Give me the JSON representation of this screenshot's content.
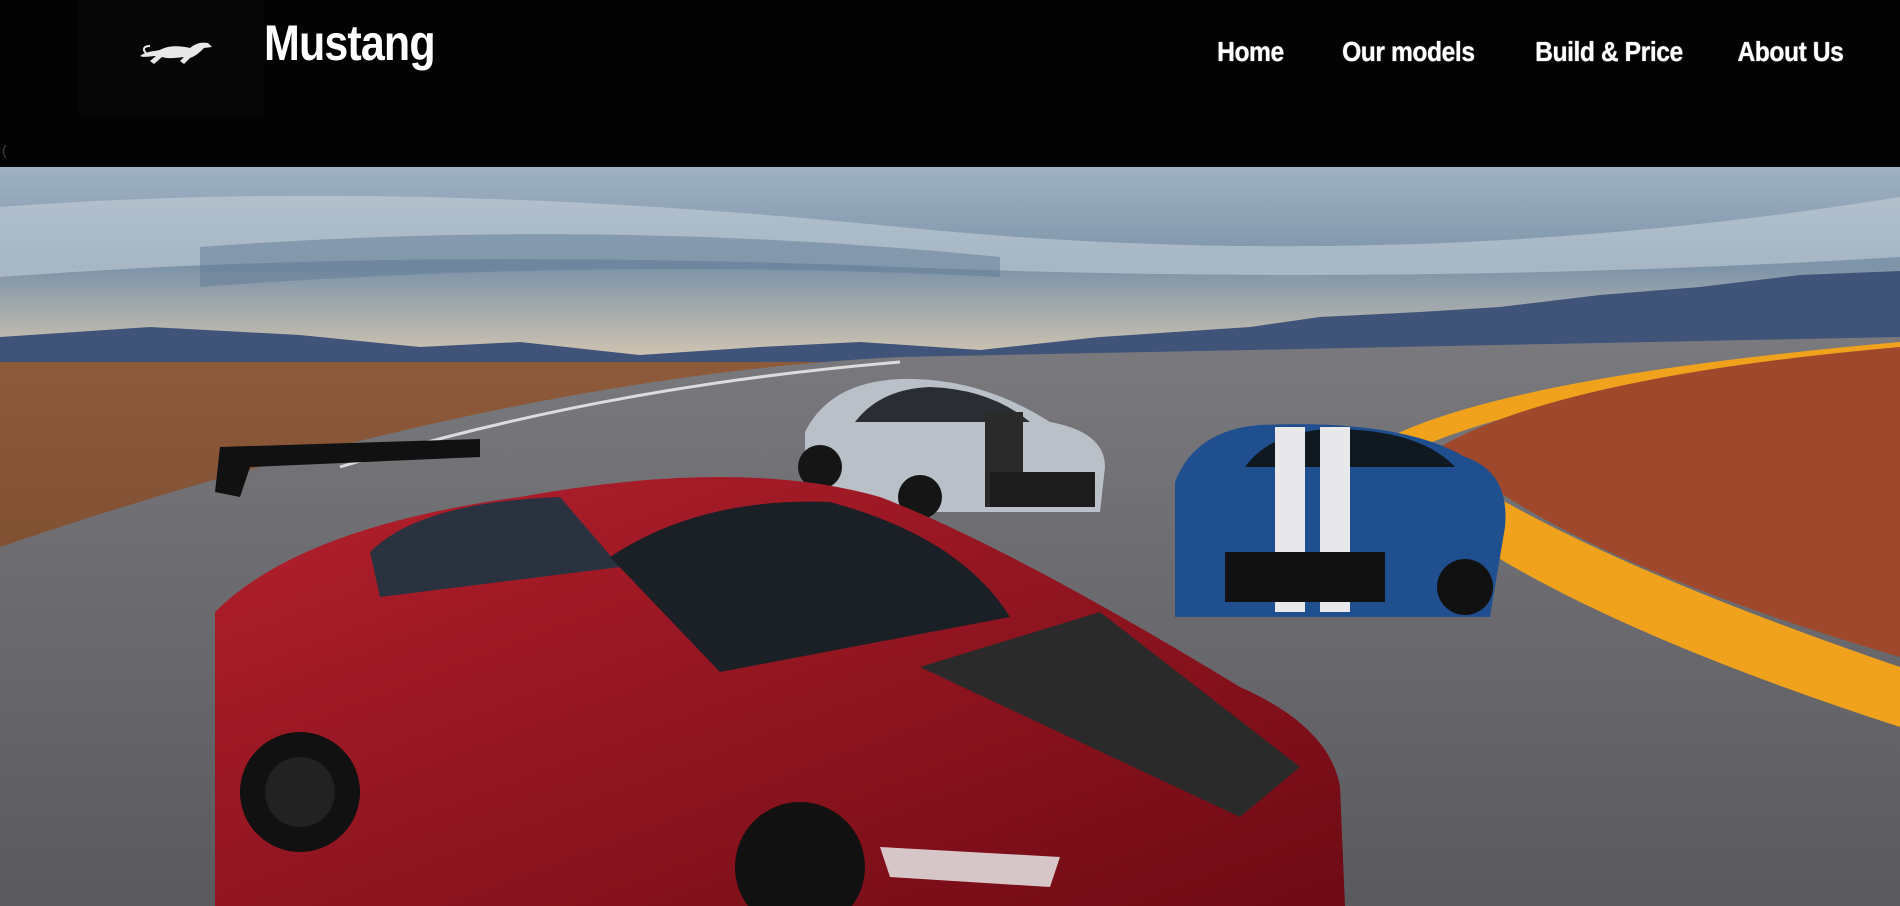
{
  "brand": {
    "name": "Mustang",
    "logo_icon": "running-horse-icon"
  },
  "nav": {
    "items": [
      {
        "label": "Home"
      },
      {
        "label": "Our models"
      },
      {
        "label": "Build & Price"
      },
      {
        "label": "About Us"
      }
    ]
  },
  "hero": {
    "image": "three Ford Mustang Shelby GT500 cars (red, silver, blue) on a desert race track",
    "colors": {
      "red_car": "#9b0f1c",
      "silver_car": "#b9c0c8",
      "blue_car": "#1f4f8e",
      "curb_yellow": "#f0a21c"
    }
  },
  "stray_glyph": "("
}
